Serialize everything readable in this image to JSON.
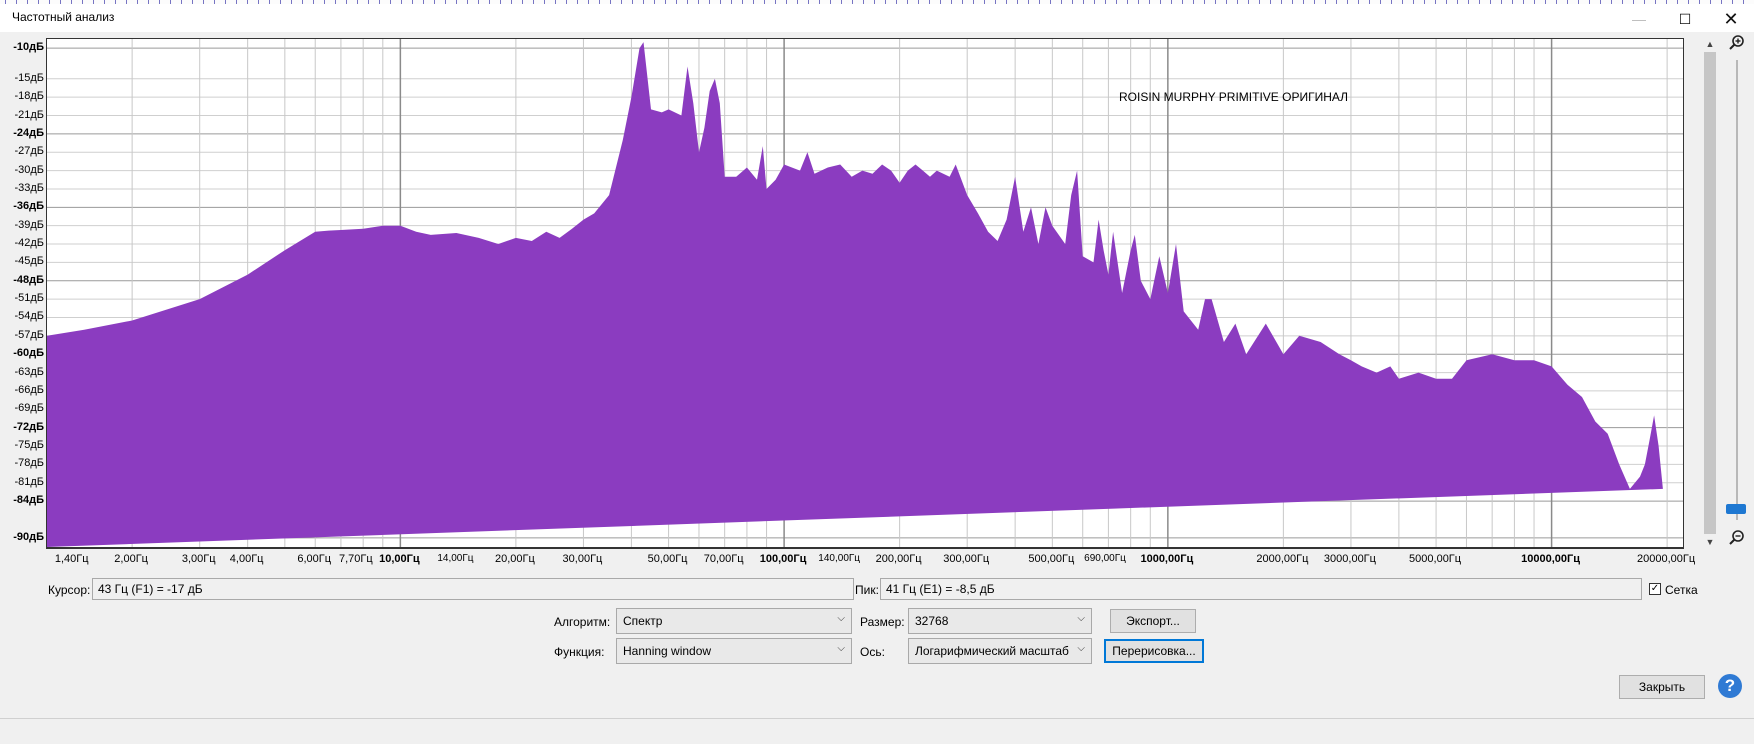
{
  "window": {
    "title": "Частотный анализ",
    "min": "—",
    "max": "☐",
    "close": "✕"
  },
  "chart_data": {
    "type": "area",
    "title": "ROISIN MURPHY PRIMITIVE ОРИГИНАЛ",
    "xscale": "log",
    "xlim": [
      1.2,
      22000
    ],
    "ylim": [
      -91.5,
      -8.5
    ],
    "fill_color": "#8b3cc0",
    "grid": true,
    "y_ticks": [
      {
        "label": "-10дБ",
        "v": -10,
        "bold": true
      },
      {
        "label": "-15дБ",
        "v": -15
      },
      {
        "label": "-18дБ",
        "v": -18
      },
      {
        "label": "-21дБ",
        "v": -21
      },
      {
        "label": "-24дБ",
        "v": -24,
        "bold": true
      },
      {
        "label": "-27дБ",
        "v": -27
      },
      {
        "label": "-30дБ",
        "v": -30
      },
      {
        "label": "-33дБ",
        "v": -33
      },
      {
        "label": "-36дБ",
        "v": -36,
        "bold": true
      },
      {
        "label": "-39дБ",
        "v": -39
      },
      {
        "label": "-42дБ",
        "v": -42
      },
      {
        "label": "-45дБ",
        "v": -45
      },
      {
        "label": "-48дБ",
        "v": -48,
        "bold": true
      },
      {
        "label": "-51дБ",
        "v": -51
      },
      {
        "label": "-54дБ",
        "v": -54
      },
      {
        "label": "-57дБ",
        "v": -57
      },
      {
        "label": "-60дБ",
        "v": -60,
        "bold": true
      },
      {
        "label": "-63дБ",
        "v": -63
      },
      {
        "label": "-66дБ",
        "v": -66
      },
      {
        "label": "-69дБ",
        "v": -69
      },
      {
        "label": "-72дБ",
        "v": -72,
        "bold": true
      },
      {
        "label": "-75дБ",
        "v": -75
      },
      {
        "label": "-78дБ",
        "v": -78
      },
      {
        "label": "-81дБ",
        "v": -81
      },
      {
        "label": "-84дБ",
        "v": -84,
        "bold": true
      },
      {
        "label": "-90дБ",
        "v": -90,
        "bold": true
      }
    ],
    "x_ticks": [
      {
        "label": "1,40Гц",
        "v": 1.4
      },
      {
        "label": "2,00Гц",
        "v": 2
      },
      {
        "label": "3,00Гц",
        "v": 3
      },
      {
        "label": "4,00Гц",
        "v": 4
      },
      {
        "label": "6,00Гц",
        "v": 6
      },
      {
        "label": "7,70Гц",
        "v": 7.7
      },
      {
        "label": "10,00Гц",
        "v": 10,
        "bold": true
      },
      {
        "label": "14,00Гц",
        "v": 14,
        "small": true
      },
      {
        "label": "20,00Гц",
        "v": 20
      },
      {
        "label": "30,00Гц",
        "v": 30
      },
      {
        "label": "50,00Гц",
        "v": 50
      },
      {
        "label": "70,00Гц",
        "v": 70
      },
      {
        "label": "100,00Гц",
        "v": 100,
        "bold": true
      },
      {
        "label": "140,00Гц",
        "v": 140,
        "small": true
      },
      {
        "label": "200,00Гц",
        "v": 200
      },
      {
        "label": "300,00Гц",
        "v": 300
      },
      {
        "label": "500,00Гц",
        "v": 500
      },
      {
        "label": "690,00Гц",
        "v": 690,
        "small": true
      },
      {
        "label": "1000,00Гц",
        "v": 1000,
        "bold": true
      },
      {
        "label": "2000,00Гц",
        "v": 2000
      },
      {
        "label": "3000,00Гц",
        "v": 3000
      },
      {
        "label": "5000,00Гц",
        "v": 5000
      },
      {
        "label": "10000,00Гц",
        "v": 10000,
        "bold": true
      },
      {
        "label": "20000,00Гц",
        "v": 20000
      }
    ],
    "x": [
      1.2,
      1.5,
      2,
      3,
      4,
      5,
      6,
      6.5,
      7,
      8,
      9,
      10,
      11,
      12,
      14,
      16,
      18,
      20,
      22,
      24,
      26,
      28,
      30,
      32,
      35,
      38,
      40,
      42,
      43,
      45,
      48,
      50,
      54,
      56,
      58,
      60,
      62,
      64,
      66,
      68,
      70,
      75,
      80,
      85,
      88,
      90,
      95,
      100,
      110,
      115,
      120,
      130,
      140,
      150,
      160,
      170,
      180,
      190,
      200,
      210,
      220,
      230,
      240,
      250,
      260,
      270,
      280,
      300,
      320,
      340,
      360,
      380,
      400,
      420,
      440,
      460,
      480,
      500,
      540,
      560,
      580,
      600,
      640,
      660,
      680,
      700,
      720,
      760,
      800,
      820,
      850,
      900,
      950,
      1000,
      1050,
      1100,
      1200,
      1250,
      1300,
      1400,
      1500,
      1600,
      1800,
      2000,
      2200,
      2500,
      2800,
      3000,
      3200,
      3500,
      3800,
      4000,
      4500,
      5000,
      5500,
      6000,
      7000,
      8000,
      9000,
      10000,
      11000,
      12000,
      13000,
      14000,
      15000,
      16000,
      17000,
      17500,
      18000,
      18500,
      19000,
      19500,
      20000
    ],
    "y": [
      -57,
      -56,
      -54.5,
      -51,
      -47,
      -43,
      -40,
      -39.8,
      -39.7,
      -39.5,
      -39,
      -39,
      -40,
      -40.5,
      -40.2,
      -41,
      -42,
      -41,
      -41.5,
      -40,
      -41,
      -39.5,
      -38,
      -37,
      -34,
      -25,
      -18,
      -10,
      -9,
      -20,
      -20.5,
      -20,
      -21,
      -13,
      -19,
      -27,
      -23,
      -17,
      -15,
      -19,
      -31,
      -31,
      -29.5,
      -31.5,
      -26,
      -33,
      -31.5,
      -29,
      -30,
      -27,
      -30.5,
      -29.5,
      -29,
      -31,
      -30,
      -30.5,
      -29,
      -30,
      -32,
      -30,
      -29,
      -30,
      -31,
      -30,
      -30.5,
      -31,
      -29,
      -34,
      -37,
      -40,
      -41.5,
      -38,
      -31,
      -40,
      -36,
      -42,
      -36,
      -39,
      -42,
      -34,
      -30,
      -44,
      -45,
      -38,
      -43,
      -47,
      -40,
      -50,
      -43,
      -40.5,
      -48,
      -51,
      -44,
      -50,
      -42,
      -53,
      -56,
      -51,
      -51,
      -58,
      -55,
      -60,
      -55,
      -60,
      -57,
      -58,
      -60,
      -61,
      -62,
      -63,
      -62,
      -64,
      -63,
      -64,
      -64,
      -61,
      -60,
      -61,
      -61,
      -62,
      -65,
      -67,
      -71,
      -73,
      -78,
      -82,
      -80,
      -78,
      -74,
      -70,
      -75,
      -82
    ]
  },
  "cursor": {
    "label": "Курсор:",
    "value": "43 Гц (F1) = -17 дБ"
  },
  "peak": {
    "label": "Пик:",
    "value": "41 Гц (E1) = -8,5 дБ"
  },
  "grid_toggle": {
    "label": "Сетка",
    "checked": "✓"
  },
  "algorithm": {
    "label": "Алгоритм:",
    "value": "Спектр"
  },
  "size": {
    "label": "Размер:",
    "value": "32768"
  },
  "function": {
    "label": "Функция:",
    "value": "Hanning window"
  },
  "axis": {
    "label": "Ось:",
    "value": "Логарифмический масштаб"
  },
  "buttons": {
    "export": "Экспорт...",
    "redraw": "Перерисовка...",
    "close": "Закрыть",
    "help": "?"
  },
  "icons": {
    "zoom_in": "zoom-in-icon",
    "zoom_out": "zoom-out-icon",
    "chevron": "chevron-down-icon"
  }
}
